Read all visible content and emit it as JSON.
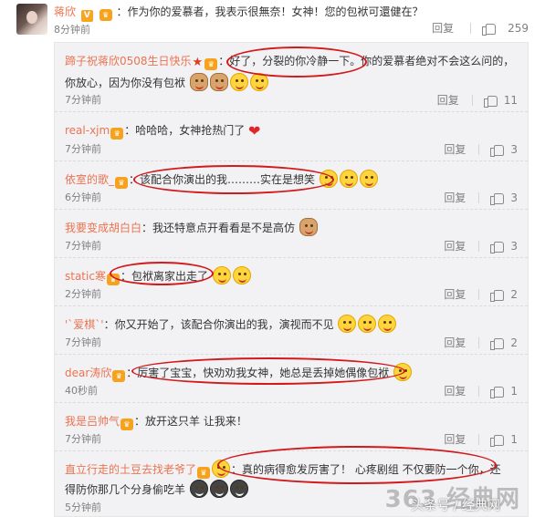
{
  "top": {
    "user": "蒋欣",
    "text": "：作为你的爱慕者，我表示很無奈！女神！您的包袱可還健在？",
    "time": "8分钟前",
    "reply_label": "回复",
    "like_count": "259"
  },
  "replies": [
    {
      "user": "蹄子祝蒋欣0508生日快乐",
      "text1": "：好了，分裂的你冷静一下。你的爱慕者绝对不会这么问的，",
      "text2": "你放心，因为你没有包袱",
      "time": "7分钟前",
      "reply_label": "回复",
      "likes": "11"
    },
    {
      "user": "real-xjm",
      "text1": "：哈哈哈，女神抢热门了",
      "time": "7分钟前",
      "reply_label": "回复",
      "likes": "3"
    },
    {
      "user": "依室的歌_",
      "text1": "：该配合你演出的我………实在是想笑",
      "time": "6分钟前",
      "reply_label": "回复",
      "likes": "3"
    },
    {
      "user": "我要变成胡白白",
      "text1": "：我还特意点开看看是不是高仿",
      "time": "7分钟前",
      "reply_label": "回复",
      "likes": "3"
    },
    {
      "user": "static寒",
      "text1": "：包袱离家出走了",
      "time": "2分钟前",
      "reply_label": "回复",
      "likes": "2"
    },
    {
      "user": "'`爱棋`'",
      "text1": "：你又开始了，该配合你演出的我，演视而不见",
      "time": "7分钟前",
      "reply_label": "回复",
      "likes": "2"
    },
    {
      "user": "dear涛欣",
      "text1": "：厉害了宝宝，快劝劝我女神，她总是丢掉她偶像包袱",
      "time": "40秒前",
      "reply_label": "回复",
      "likes": "1"
    },
    {
      "user": "我是吕帅气",
      "text1": "：放开这只羊 让我来！",
      "time": "7分钟前",
      "reply_label": "回复",
      "likes": "1"
    },
    {
      "user": "直立行走的土豆去找老爷了",
      "text1": "：真的病得愈发厉害了！ 心疼剧组  不仅要防一个你，还",
      "text2": "得防你那几个分身偷吃羊",
      "time": "5分钟前"
    }
  ],
  "watermark": {
    "big": "363 经典网",
    "small": "头条号 / 经典网"
  },
  "colors": {
    "username": "#eb7350",
    "highlight": "#d2191b",
    "background": "#f2f2f5"
  }
}
